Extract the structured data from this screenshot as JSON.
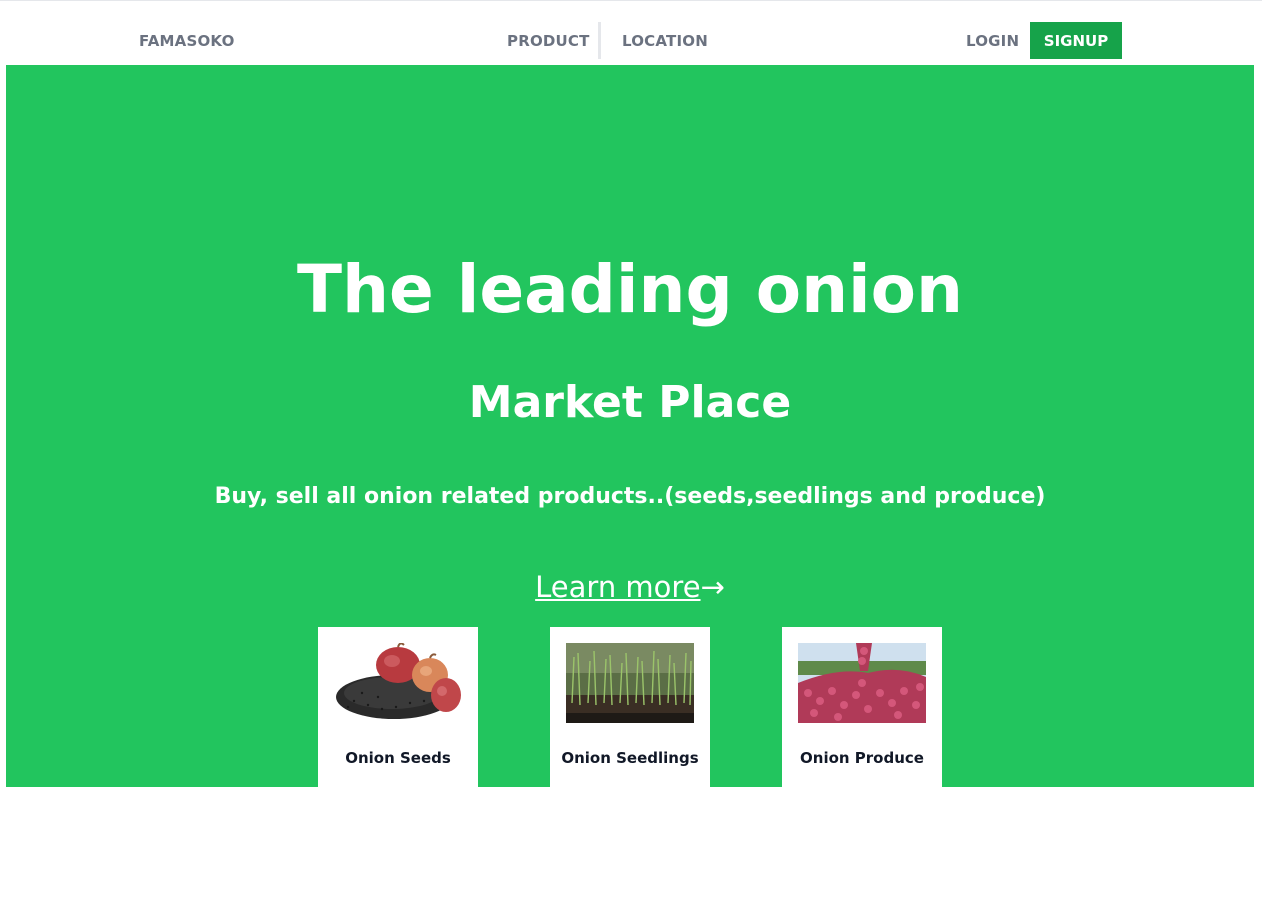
{
  "nav": {
    "brand": "FAMASOKO",
    "links": [
      "PRODUCT",
      "LOCATION"
    ],
    "login": "LOGIN",
    "signup": "SIGNUP"
  },
  "hero": {
    "title": "The leading onion",
    "subtitle": "Market Place",
    "tagline": "Buy, sell all onion related products..(seeds,seedlings and produce)",
    "cta_label": "Learn more",
    "cta_arrow": "→"
  },
  "products": [
    {
      "label": "Onion Seeds"
    },
    {
      "label": "Onion Seedlings"
    },
    {
      "label": "Onion Produce"
    }
  ],
  "colors": {
    "hero_bg": "#22c55e",
    "signup_bg": "#16a34a",
    "nav_text": "#6b7280"
  }
}
